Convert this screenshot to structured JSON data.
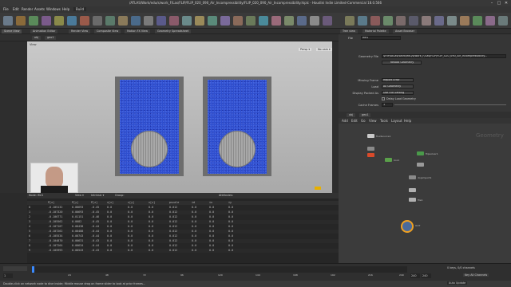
{
  "window": {
    "title": "/ATLAS/Work/edu/s/work_F/Las/FLIP/FLIP_020_090_Air_Incompressibility/FLIP_020_090_Air_Incompressibility.hiplc - Houdini Indie Limited-Commercial 18.0.566",
    "minimize": "–",
    "maximize": "□",
    "close": "✕"
  },
  "menu": [
    "File",
    "Edit",
    "Render",
    "Assets",
    "Windows",
    "Help"
  ],
  "toolbar": {
    "desktop": "Build"
  },
  "viewport_tabs": [
    "Scene View",
    "Animation Editor",
    "Render View",
    "Composite View",
    "Motion FX View",
    "Geometry Spreadsheet"
  ],
  "viewport": {
    "path": "obj",
    "node": "geo1",
    "label": "View",
    "cam_label": "Persp ▾",
    "cam_menu": "No cam ▾"
  },
  "param_tabs": [
    "Tree view",
    "Material Palette",
    "Asset Browser"
  ],
  "params": {
    "node_type": "File",
    "node_name": "file1",
    "rows": [
      {
        "label": "Geometry File",
        "value": "$HIP/AtLas/Work/edu/s/work_F/Las/FLIP/FLIP_020_090_Air_Incompressibility..."
      },
      {
        "label": "",
        "value": "Reload Geometry"
      },
      {
        "label": "Missing Frame",
        "value": "Report Error"
      },
      {
        "label": "Load",
        "value": "All Geometry"
      },
      {
        "label": "Display Packed As",
        "value": "Use File Setting"
      },
      {
        "label": "",
        "value": "Delay Load Geometry"
      },
      {
        "label": "Cache Frames",
        "value": "1"
      }
    ]
  },
  "network": {
    "path": "obj",
    "node": "geo1",
    "watermark": "Geometry",
    "menu": [
      "Add",
      "Edit",
      "Go",
      "View",
      "Tools",
      "Layout",
      "Help"
    ],
    "nodes": [
      "fluidsource1",
      "null1",
      "vdbfrompolygons1",
      "box1",
      "flipsolver1",
      "transform1",
      "dopimport1",
      "sphere1",
      "file1",
      "OUT"
    ]
  },
  "spreadsheet": {
    "node": "Node: file1",
    "view": "View ▾",
    "intrinsic": "Intrinsic ▾",
    "group": "Group:",
    "attributes": "Attributes:",
    "columns": [
      "",
      "P[x]",
      "P[y]",
      "P[z]",
      "v[x]",
      "v[y]",
      "v[z]",
      "pscale",
      "id",
      "ix",
      "iy"
    ],
    "rows": [
      [
        "0",
        "-0.105132",
        "0.00693",
        "-0.45",
        "0.0",
        "0.0",
        "0.0",
        "0.012",
        "0.0",
        "0.0",
        "0.0"
      ],
      [
        "1",
        "-0.107320",
        "0.00693",
        "-0.45",
        "0.0",
        "0.0",
        "0.0",
        "0.012",
        "0.0",
        "0.0",
        "0.0"
      ],
      [
        "2",
        "-0.106771",
        "0.01151",
        "-0.46",
        "0.0",
        "0.0",
        "0.0",
        "0.012",
        "0.0",
        "0.0",
        "0.0"
      ],
      [
        "3",
        "-0.105562",
        "0.0082",
        "-0.45",
        "0.0",
        "0.0",
        "0.0",
        "0.012",
        "0.0",
        "0.0",
        "0.0"
      ],
      [
        "4",
        "-0.107107",
        "0.00438",
        "-0.44",
        "0.0",
        "0.0",
        "0.0",
        "0.012",
        "0.0",
        "0.0",
        "0.0"
      ],
      [
        "5",
        "-0.107262",
        "0.00488",
        "-0.44",
        "0.0",
        "0.0",
        "0.0",
        "0.012",
        "0.0",
        "0.0",
        "0.0"
      ],
      [
        "6",
        "-0.105534",
        "0.00743",
        "-0.44",
        "0.0",
        "0.0",
        "0.0",
        "0.012",
        "0.0",
        "0.0",
        "0.0"
      ],
      [
        "7",
        "-0.104870",
        "0.00631",
        "-0.43",
        "0.0",
        "0.0",
        "0.0",
        "0.012",
        "0.0",
        "0.0",
        "0.0"
      ],
      [
        "8",
        "-0.107264",
        "0.00634",
        "-0.44",
        "0.0",
        "0.0",
        "0.0",
        "0.012",
        "0.0",
        "0.0",
        "0.0"
      ],
      [
        "9",
        "-0.105993",
        "0.00543",
        "-0.43",
        "0.0",
        "0.0",
        "0.0",
        "0.012",
        "0.0",
        "0.0",
        "0.0"
      ]
    ]
  },
  "timeline": {
    "frame": "1",
    "start": "1",
    "end": "240",
    "end2": "240",
    "ticks": [
      "24",
      "48",
      "72",
      "96",
      "120",
      "144",
      "168",
      "192",
      "216",
      "240"
    ],
    "keys": "0 keys, 0/0 channels",
    "key_all": "Key All Channels",
    "auto_update": "Auto Update"
  },
  "status": "Double-click on network node to dive inside; Middle mouse drag on frame slider to look at prior frames..."
}
